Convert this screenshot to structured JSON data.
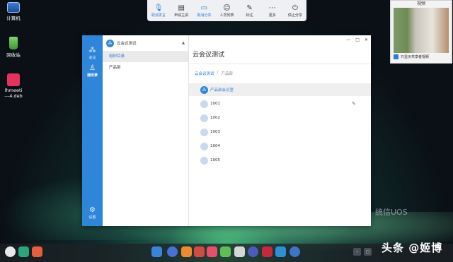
{
  "desktop": {
    "icons": [
      {
        "label": "计算机"
      },
      {
        "label": "回收站"
      },
      {
        "label": "lhmeeti\n---4.deb"
      }
    ]
  },
  "toolbar": {
    "items": [
      {
        "label": "取消发言",
        "icon": "mic-icon",
        "active": true
      },
      {
        "label": "申请主讲",
        "icon": "request-speaker-icon",
        "active": false
      },
      {
        "label": "取消分享",
        "icon": "camera-icon",
        "active": true
      },
      {
        "label": "人员列表",
        "icon": "people-icon",
        "active": false
      },
      {
        "label": "标注",
        "icon": "pen-icon",
        "active": false
      },
      {
        "label": "更多",
        "icon": "more-icon",
        "active": false
      },
      {
        "label": "停止分享",
        "icon": "power-icon",
        "active": false
      }
    ]
  },
  "video_panel": {
    "title": "视频",
    "checkbox_label": "只显示共享者视频",
    "checked": true
  },
  "app": {
    "rail": [
      {
        "label": "会议",
        "icon": "meeting-icon"
      },
      {
        "label": "通讯录",
        "icon": "contacts-icon"
      },
      {
        "label": "设置",
        "icon": "settings-icon"
      }
    ],
    "tree": {
      "org_name": "云会议测试",
      "items": [
        {
          "label": "组织目录",
          "selected": true
        },
        {
          "label": "产品部",
          "selected": false
        }
      ]
    },
    "main": {
      "title": "云会议测试",
      "breadcrumb": [
        "云会议测试",
        "/",
        "产品部"
      ],
      "group_label": "产品部会议室",
      "users": [
        "1001",
        "1002",
        "1003",
        "1004",
        "1005"
      ]
    }
  },
  "watermark": "统信UOS",
  "attribution": "头条 @姬博",
  "colors": {
    "accent": "#2f86d8",
    "selected_text": "#2f7bd8"
  }
}
